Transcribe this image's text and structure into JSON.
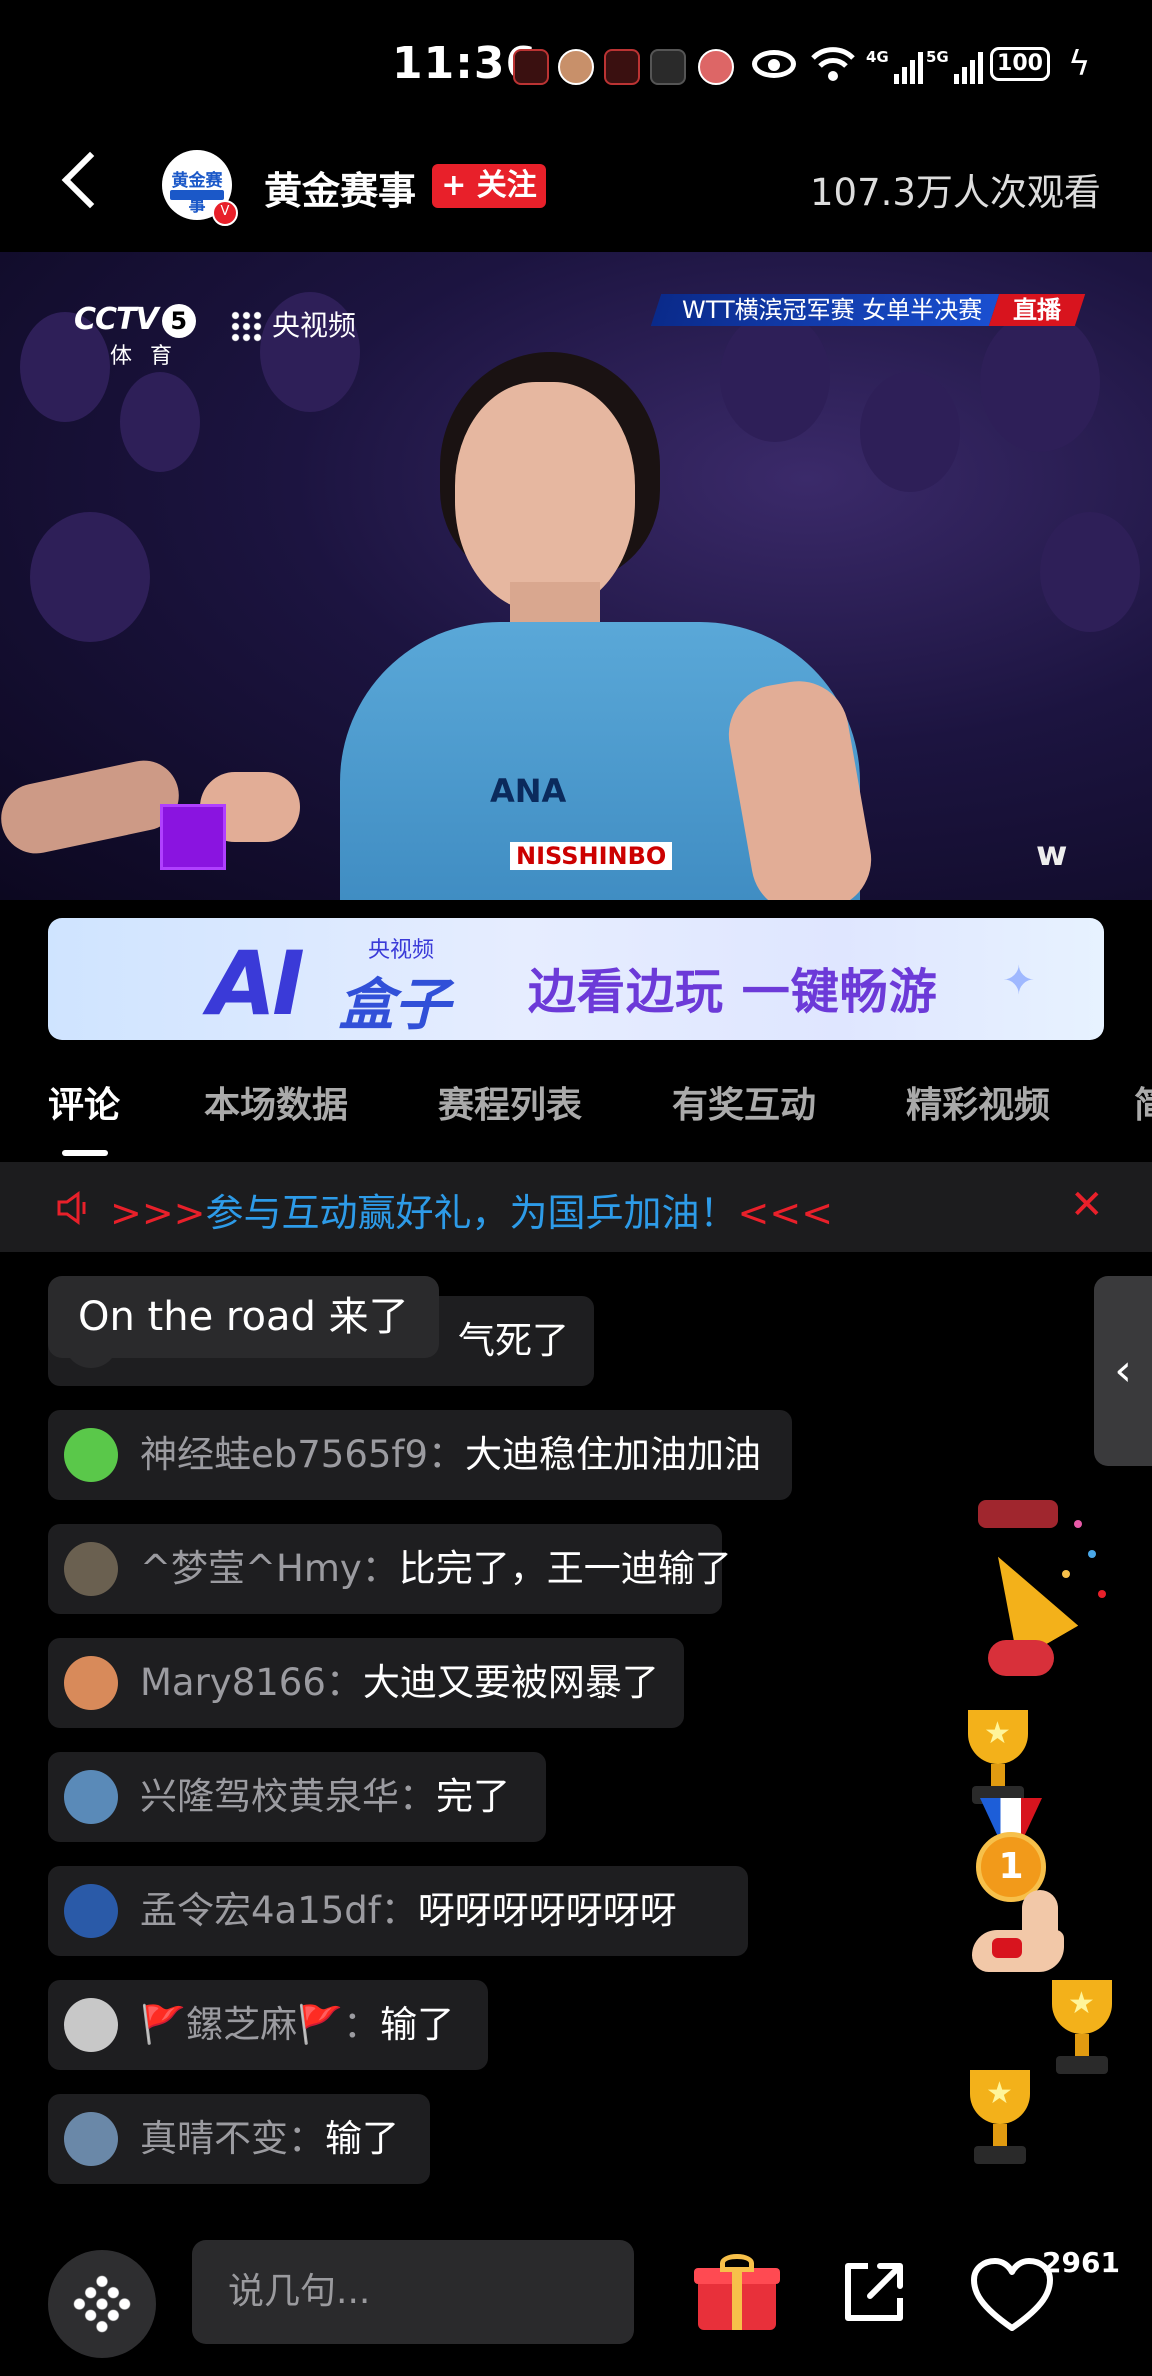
{
  "status_bar": {
    "time": "11:36",
    "battery": "100",
    "net1": "4G",
    "net2": "5G"
  },
  "header": {
    "avatar_text": "黄金赛事",
    "channel_name": "黄金赛事",
    "follow_label": "+ 关注",
    "viewer_count": "107.3万人次观看"
  },
  "video": {
    "broadcaster": "CCTV",
    "channel_number": "5",
    "broadcaster_sub": "体育",
    "app_logo": "央视频",
    "match_title": "WTT横滨冠军赛 女单半决赛",
    "live_label": "直播",
    "shirt_logo": "ANA",
    "shirt_brand": "NISSHINBO"
  },
  "ai_banner": {
    "big": "AI",
    "box": "盒子",
    "small": "央视频",
    "slogan": "边看边玩 一键畅游"
  },
  "tabs": [
    "评论",
    "本场数据",
    "赛程列表",
    "有奖互动",
    "精彩视频",
    "简"
  ],
  "notice": {
    "prefix": ">>>",
    "text": "参与互动赢好礼，为国乒加油！",
    "suffix": "<<<"
  },
  "entry_toast": "On the road 来了",
  "comments": [
    {
      "name": "",
      "text": "气死了"
    },
    {
      "name": "神经蛙eb7565f9：",
      "text": "大迪稳住加油加油"
    },
    {
      "name": "^梦莹^Hmy：",
      "text": "比完了，王一迪输了"
    },
    {
      "name": "Mary8166：",
      "text": "大迪又要被网暴了"
    },
    {
      "name": "兴隆驾校黄泉华：",
      "text": "完了"
    },
    {
      "name": "孟令宏4a15df：",
      "text": "呀呀呀呀呀呀呀"
    },
    {
      "name": "🚩鏍芝麻🚩：",
      "text": "输了"
    },
    {
      "name": "真晴不变：",
      "text": "输了"
    }
  ],
  "bottom_bar": {
    "input_placeholder": "说几句...",
    "like_count": "2961"
  },
  "colors": {
    "accent_red": "#e8202a",
    "link_blue": "#2d9be8",
    "comment_bg": "#1e1e20"
  }
}
